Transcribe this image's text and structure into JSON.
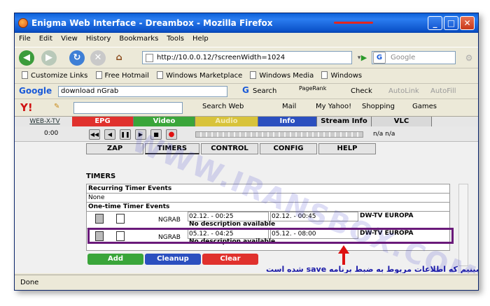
{
  "window": {
    "title": "Enigma Web Interface - Dreambox - Mozilla Firefox"
  },
  "menu": [
    "File",
    "Edit",
    "View",
    "History",
    "Bookmarks",
    "Tools",
    "Help"
  ],
  "address": {
    "url": "http://10.0.0.12/?screenWidth=1024",
    "search_placeholder": "Google"
  },
  "bookmarks": [
    "Customize Links",
    "Free Hotmail",
    "Windows Marketplace",
    "Windows Media",
    "Windows"
  ],
  "google_toolbar": {
    "brand": "Google",
    "search_value": "download nGrab",
    "search_label": "Search",
    "pagerank": "PageRank",
    "check": "Check",
    "autolink": "AutoLink",
    "autofill": "AutoFill"
  },
  "yahoo_toolbar": {
    "brand": "Y!",
    "search_web": "Search Web",
    "mail": "Mail",
    "my_yahoo": "My Yahoo!",
    "shopping": "Shopping",
    "games": "Games"
  },
  "top_nav": {
    "webx": "WEB-X-TV",
    "tabs": [
      {
        "label": "EPG",
        "color": "#e0312d"
      },
      {
        "label": "Video",
        "color": "#3aa53a"
      },
      {
        "label": "Audio",
        "color": "#d8c33b"
      },
      {
        "label": "Info",
        "color": "#2b4fbf"
      },
      {
        "label": "Stream Info",
        "color": "#d9d9d9"
      },
      {
        "label": "VLC",
        "color": "#d9d9d9"
      }
    ]
  },
  "player": {
    "time": "0:00",
    "rate": "n/a n/a"
  },
  "sub_nav": [
    "ZAP",
    "TIMERS",
    "CONTROL",
    "CONFIG",
    "HELP"
  ],
  "page": {
    "heading": "TIMERS"
  },
  "timers": {
    "recurring_label": "Recurring Timer Events",
    "none_label": "None",
    "one_time_label": "One-time Timer Events",
    "rows": [
      {
        "type": "NGRAB",
        "start": "02.12. - 00:25",
        "end": "02.12. - 00:45",
        "channel": "DW-TV EUROPA",
        "desc": "No description available"
      },
      {
        "type": "NGRAB",
        "start": "05.12. - 04:25",
        "end": "05.12. - 08:00",
        "channel": "DW-TV EUROPA",
        "desc": "No description available"
      }
    ]
  },
  "actions": {
    "add": "Add",
    "cleanup": "Cleanup",
    "clear": "Clear"
  },
  "status": {
    "text": "Done"
  },
  "annotation": {
    "text": "در این صفحه هم میبینیم که اطلاعات مربوط به ضبط برنامه save شده است"
  },
  "watermark": "WWW.IRANSBOX.COM"
}
